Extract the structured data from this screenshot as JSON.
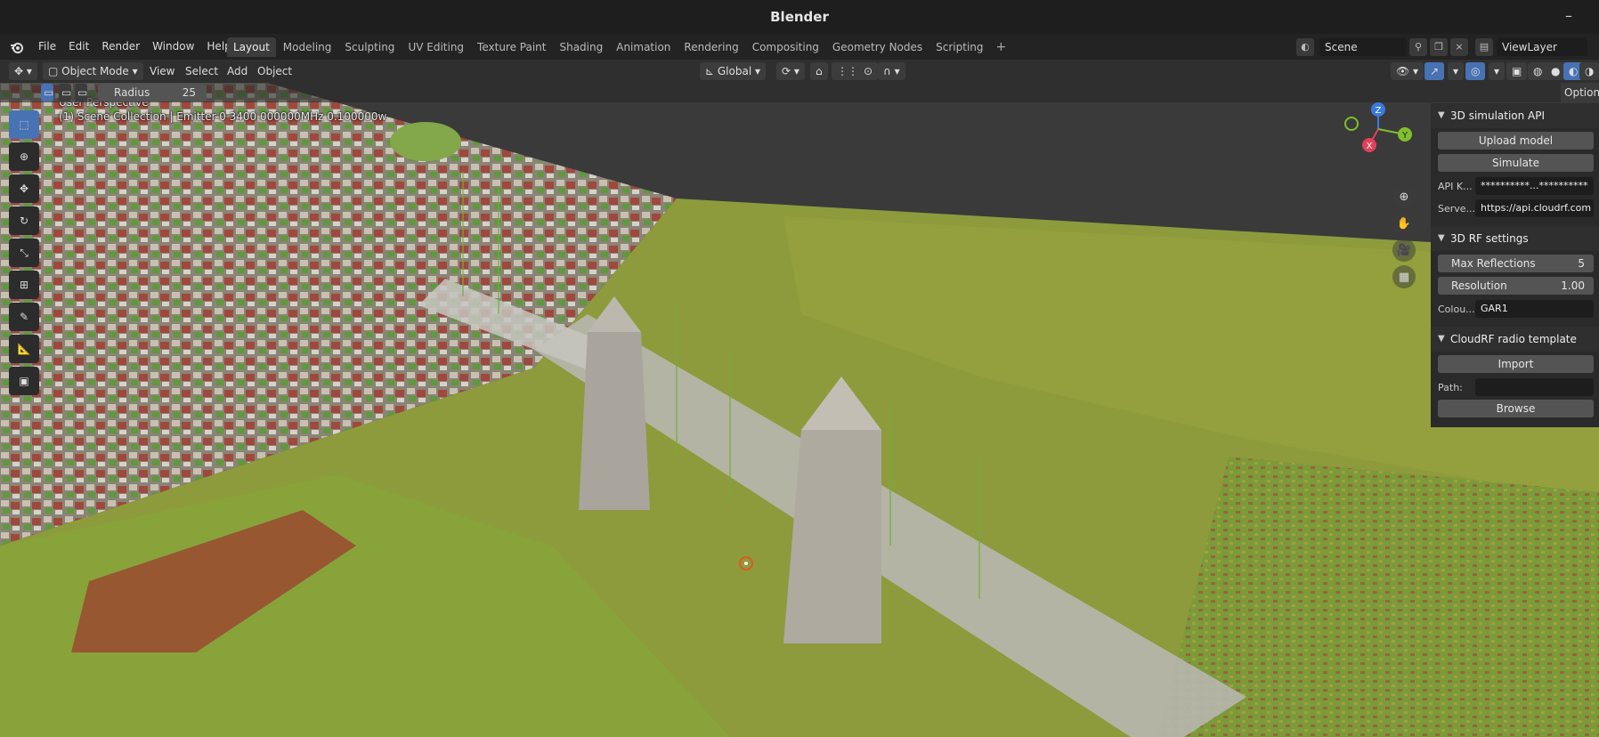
{
  "window": {
    "title": "Blender"
  },
  "menu": {
    "items": [
      "File",
      "Edit",
      "Render",
      "Window",
      "Help"
    ]
  },
  "workspaces": {
    "tabs": [
      "Layout",
      "Modeling",
      "Sculpting",
      "UV Editing",
      "Texture Paint",
      "Shading",
      "Animation",
      "Rendering",
      "Compositing",
      "Geometry Nodes",
      "Scripting"
    ],
    "active": "Layout"
  },
  "scene": {
    "name": "Scene",
    "view_layer": "ViewLayer"
  },
  "header": {
    "mode": "Object Mode",
    "view": "View",
    "select": "Select",
    "add": "Add",
    "object": "Object",
    "orientation": "Global"
  },
  "tool_settings": {
    "radius_label": "Radius",
    "radius_value": "25",
    "options": "Options"
  },
  "viewport": {
    "perspective": "User Perspective",
    "collection_info": "(1) Scene Collection | Emitter-0 3400.000000MHz 0.100000w"
  },
  "gizmo": {
    "z": "Z",
    "y": "Y",
    "x": "X"
  },
  "panel_api": {
    "title": "3D simulation API",
    "upload": "Upload model",
    "simulate": "Simulate",
    "api_key_label": "API K...",
    "api_key_value": "**********...**********",
    "server_label": "Serve...",
    "server_value": "https://api.cloudrf.com"
  },
  "panel_rf": {
    "title": "3D RF settings",
    "max_reflections_label": "Max Reflections",
    "max_reflections_value": "5",
    "resolution_label": "Resolution",
    "resolution_value": "1.00",
    "colour_label": "Colou...",
    "colour_value": "GAR1"
  },
  "panel_template": {
    "title": "CloudRF radio template",
    "import": "Import",
    "path_label": "Path:",
    "path_value": "",
    "browse": "Browse"
  },
  "colors": {
    "accent": "#4772b3",
    "coverage_green": "#7fa53a",
    "coverage_red": "#b5402c",
    "coverage_yellow": "#a6a83a"
  }
}
